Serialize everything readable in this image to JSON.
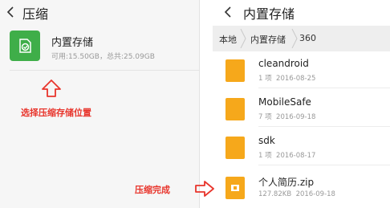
{
  "colors": {
    "accent_green": "#3fae49",
    "folder_orange": "#f6a81b",
    "annotation_red": "#e8352c"
  },
  "left": {
    "back_icon": "chevron-left-icon",
    "title": "压缩",
    "storage": {
      "icon": "storage-icon",
      "name": "内置存储",
      "detail": "可用:15.50GB，总共:25.09GB"
    },
    "annotation": "选择压缩存储位置"
  },
  "right": {
    "back_icon": "chevron-left-icon",
    "title": "内置存储",
    "breadcrumb": [
      "本地",
      "内置存储",
      "360"
    ],
    "files": [
      {
        "name": "cleandroid",
        "count": "1 项",
        "date": "2016-08-25",
        "type": "folder"
      },
      {
        "name": "MobileSafe",
        "count": "7 项",
        "date": "2016-09-18",
        "type": "folder"
      },
      {
        "name": "sdk",
        "count": "1 项",
        "date": "2016-08-17",
        "type": "folder"
      },
      {
        "name": "个人简历.zip",
        "count": "127.82KB",
        "date": "2016-09-18",
        "type": "zip"
      }
    ]
  },
  "annotation_done": "压缩完成"
}
